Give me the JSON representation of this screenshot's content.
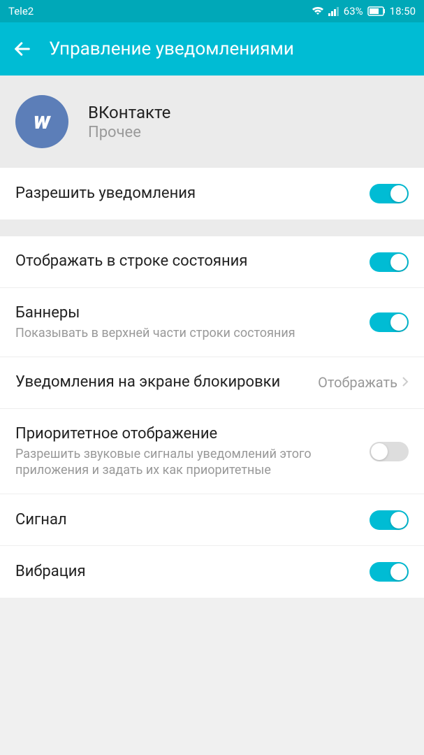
{
  "statusBar": {
    "carrier": "Tele2",
    "battery": "63%",
    "time": "18:50"
  },
  "header": {
    "title": "Управление уведомлениями"
  },
  "app": {
    "name": "ВКонтакте",
    "category": "Прочее",
    "iconLetter": "w"
  },
  "settings": {
    "allowNotifications": {
      "title": "Разрешить уведомления",
      "enabled": true
    },
    "statusBar": {
      "title": "Отображать в строке состояния",
      "enabled": true
    },
    "banners": {
      "title": "Баннеры",
      "subtitle": "Показывать в верхней части строки состояния",
      "enabled": true
    },
    "lockScreen": {
      "title": "Уведомления на экране блокировки",
      "value": "Отображать"
    },
    "priority": {
      "title": "Приоритетное отображение",
      "subtitle": "Разрешить звуковые сигналы уведомлений этого приложения и задать их как приоритетные",
      "enabled": false
    },
    "sound": {
      "title": "Сигнал",
      "enabled": true
    },
    "vibration": {
      "title": "Вибрация",
      "enabled": true
    }
  }
}
